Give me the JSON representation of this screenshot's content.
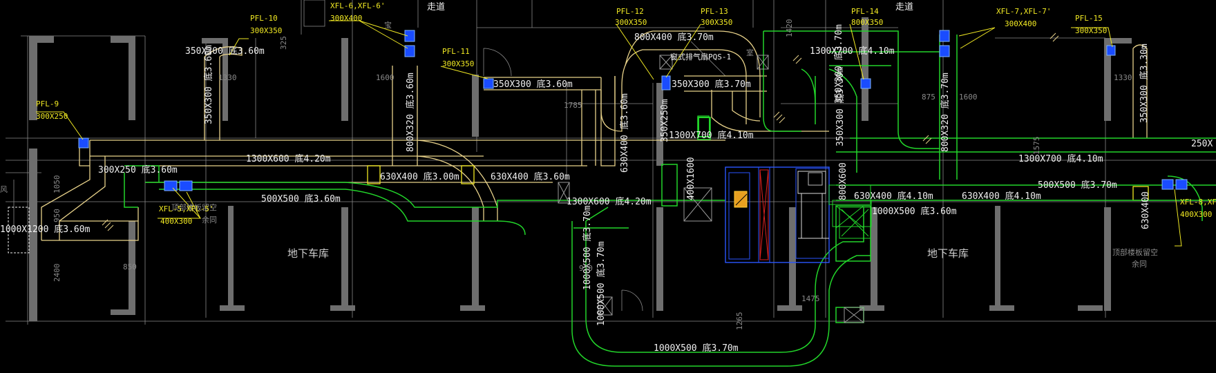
{
  "drawing": {
    "corridor_labels": [
      "走道",
      "走道"
    ],
    "garage_labels": [
      "地下车库",
      "地下车库"
    ],
    "reserve_labels": [
      {
        "line1": "顶部楼板留空",
        "line2": "余同"
      },
      {
        "line1": "顶部楼板留空",
        "line2": "余同"
      }
    ],
    "equipment_label": "窗式排气扇PQS-1",
    "duct_labels": [
      "350X300 底3.60m",
      "350X300 底3.60m",
      "800X320 底3.60m",
      "300X250 底3.60m",
      "1300X600 底4.20m",
      "630X400 底3.00m",
      "630X400 底3.60m",
      "500X500 底3.60m",
      "1000X1200 底3.60m",
      "350X300 底3.60m",
      "800X400 底3.70m",
      "350X300 底3.70m",
      "630X400 底3.60m",
      "1300X600 底4.20m",
      "350X250m",
      "1300X700 底4.10m",
      "400X1600",
      "1000X500 底3.70m",
      "1000X500 底3.70m",
      "1300X700 底4.10m",
      "350X300 底3.70m",
      "350X300 底3.30m",
      "800X600",
      "630X400 底4.10m",
      "1000X500 底3.60m",
      "630X400 底4.10m",
      "800X320 底3.70m",
      "1300X700 底4.10m",
      "500X500 底3.70m",
      "350X300 底3.30m",
      "630X400",
      "250X",
      "1000X500 底3.70m"
    ],
    "tags": [
      {
        "name": "PFL-9",
        "size": "300X250"
      },
      {
        "name": "PFL-10",
        "size": "300X350"
      },
      {
        "name": "XFL-6,XFL-6'",
        "size": "300X400"
      },
      {
        "name": "PFL-11",
        "size": "300X350"
      },
      {
        "name": "PFL-12",
        "size": "300X350"
      },
      {
        "name": "PFL-13",
        "size": "300X350"
      },
      {
        "name": "PFL-14",
        "size": "800X350"
      },
      {
        "name": "XFL-7,XFL-7'",
        "size": "300X400"
      },
      {
        "name": "PFL-15",
        "size": "300X350"
      },
      {
        "name": "XFL-5,XFL-5'",
        "size": "400X300"
      },
      {
        "name": "XFL-8,XFL",
        "size": "400X300"
      }
    ],
    "dimensions": [
      "325",
      "1600",
      "1330",
      "1050",
      "950",
      "2400",
      "850",
      "1785",
      "950",
      "1265",
      "1475",
      "875",
      "1600",
      "1330",
      "1420",
      "1575"
    ],
    "partial_labels": [
      "风",
      "室",
      "宝"
    ],
    "colors": {
      "background": "#000000",
      "supply_duct": "#e8d28a",
      "exhaust_duct": "#22d52a",
      "tag_text": "#f2ea23",
      "wall": "#6e6e6e",
      "equipment": "#1a4cff"
    }
  }
}
